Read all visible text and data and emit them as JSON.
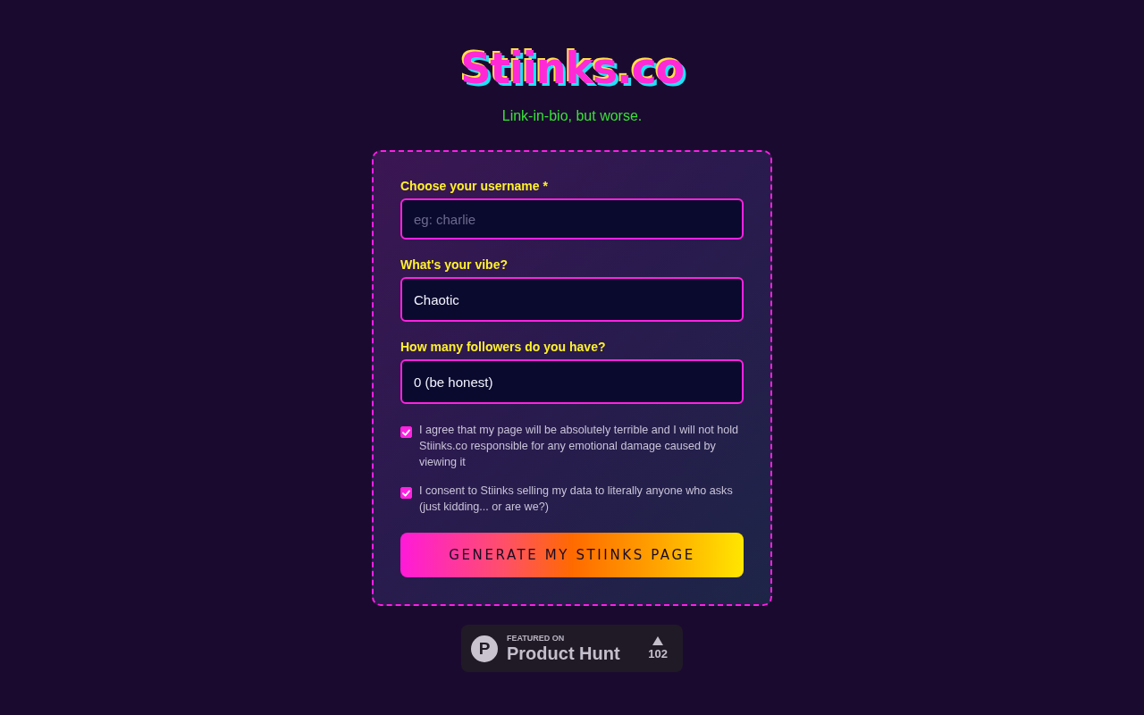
{
  "header": {
    "title": "Stiinks.co",
    "tagline": "Link-in-bio, but worse."
  },
  "form": {
    "fields": [
      {
        "label": "Choose your username *",
        "placeholder": "eg: charlie"
      },
      {
        "label": "What's your vibe?",
        "value": "Chaotic"
      },
      {
        "label": "How many followers do you have?",
        "value": "0 (be honest)"
      }
    ],
    "agreements": [
      {
        "text": "I agree that my page will be absolutely terrible and I will not hold Stiinks.co responsible for any emotional damage caused by viewing it",
        "checked": true
      },
      {
        "text": "I consent to Stiinks selling my data to literally anyone who asks (just kidding... or are we?)",
        "checked": true
      }
    ],
    "submit_button": "GENERATE MY STIINKS PAGE"
  },
  "product_hunt_badge": {
    "logo_letter": "P",
    "caption": "FEATURED ON",
    "name": "Product Hunt",
    "upvotes": "102"
  }
}
